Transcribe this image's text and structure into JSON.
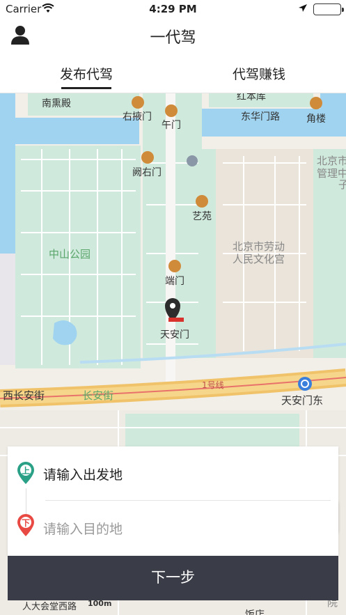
{
  "status_bar": {
    "carrier": "Carrier",
    "time": "4:29 PM"
  },
  "nav": {
    "title": "一代驾",
    "user_icon": "user-icon"
  },
  "tabs": [
    {
      "label": "发布代驾",
      "active": true
    },
    {
      "label": "代驾赚钱",
      "active": false
    }
  ],
  "map": {
    "labels": {
      "nanxundian": "南熏殿",
      "hongbenku": "红本库",
      "youyemen": "右掖门",
      "wumen": "午门",
      "donghuamenlu": "东华门路",
      "jiaolou": "角楼",
      "queyoumen": "阙右门",
      "beijingshi": "北京市",
      "guanlichu": "管理中",
      "zi": "子",
      "yiyuan": "艺苑",
      "zhongshangongyuan": "中山公园",
      "laodong1": "北京市劳动",
      "laodong2": "人民文化宫",
      "duanmen": "端门",
      "tiananmen": "天安门",
      "xichanganjie": "西长安街",
      "changanjie": "长安街",
      "line1": "1号线",
      "tiananmendong": "天安门东",
      "renmindahuitang": "人大会堂西路",
      "scale": "100m",
      "yuan": "院",
      "bottom_hotel": "饭店"
    },
    "metro_color": "#3b7fdc",
    "water_color": "#9fd3ef",
    "park_color": "#cfe9dd"
  },
  "form": {
    "start_placeholder": "请输入出发地",
    "end_placeholder": "请输入目的地",
    "start_badge": "上",
    "end_badge": "下",
    "start_color": "#2aa187",
    "end_color": "#e84a43"
  },
  "next_button": "下一步"
}
